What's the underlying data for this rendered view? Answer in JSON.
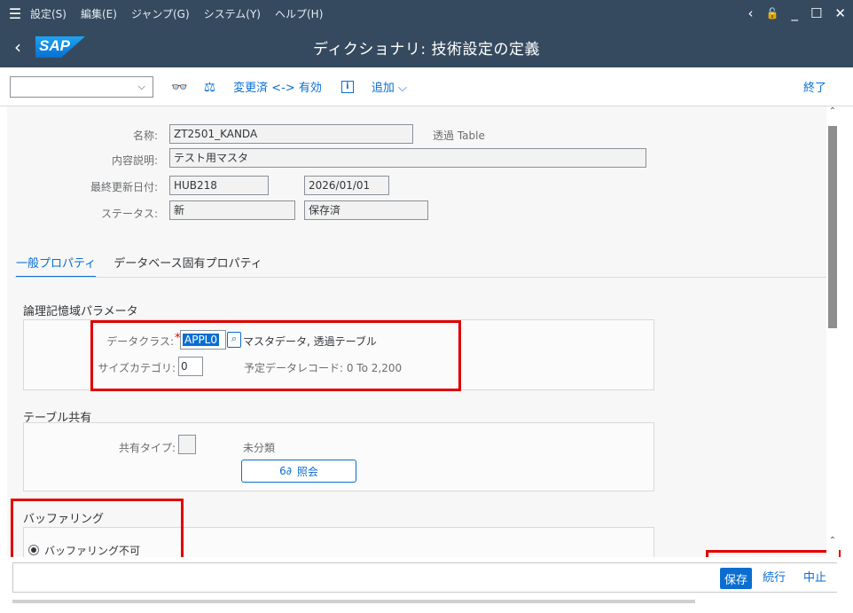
{
  "menubar": {
    "hamburger": "☰",
    "items": [
      "設定(S)",
      "編集(E)",
      "ジャンプ(G)",
      "システム(Y)",
      "ヘルプ(H)"
    ],
    "controls": {
      "back": "‹",
      "unlock": "🔓",
      "minimize": "_",
      "maximize": "☐",
      "close": "✕"
    }
  },
  "titlebar": {
    "back": "‹",
    "logo": "SAP",
    "title": "ディクショナリ: 技術設定の定義"
  },
  "toolbar": {
    "command_field_value": "",
    "dropdown_glyph": "⌵",
    "glasses_icon": "👓",
    "compare_icon": "⚖",
    "toggle_label": "変更済 <-> 有効",
    "info_label": "i",
    "add_label": "追加 ⌵",
    "exit_label": "終了"
  },
  "header_fields": {
    "name_label": "名称:",
    "name_value": "ZT2501_KANDA",
    "table_type": "透過 Table",
    "desc_label": "内容説明:",
    "desc_value": "テスト用マスタ",
    "updated_label": "最終更新日付:",
    "updated_user": "HUB218",
    "updated_date": "2026/01/01",
    "status_label": "ステータス:",
    "status_value": "新",
    "status_saved": "保存済"
  },
  "tabs": [
    {
      "label": "一般プロパティ",
      "active": true
    },
    {
      "label": "データベース固有プロパティ",
      "active": false
    }
  ],
  "logical_storage": {
    "title": "論理記憶域パラメータ",
    "data_class_label": "データクラス:",
    "required_mark": "*",
    "data_class_value": "APPL0",
    "data_class_desc": "マスタデータ, 透過テーブル",
    "size_label": "サイズカテゴリ:",
    "size_value": "0",
    "expected_records": "予定データレコード: 0 To 2,200"
  },
  "table_sharing": {
    "title": "テーブル共有",
    "type_label": "共有タイプ:",
    "type_value": "",
    "type_text": "未分類",
    "display_button": "照会",
    "display_icon": "6∂"
  },
  "buffering": {
    "title": "バッファリング",
    "option_label": "バッファリング不可"
  },
  "footer": {
    "save": "保存",
    "continue": "続行",
    "cancel": "中止"
  }
}
